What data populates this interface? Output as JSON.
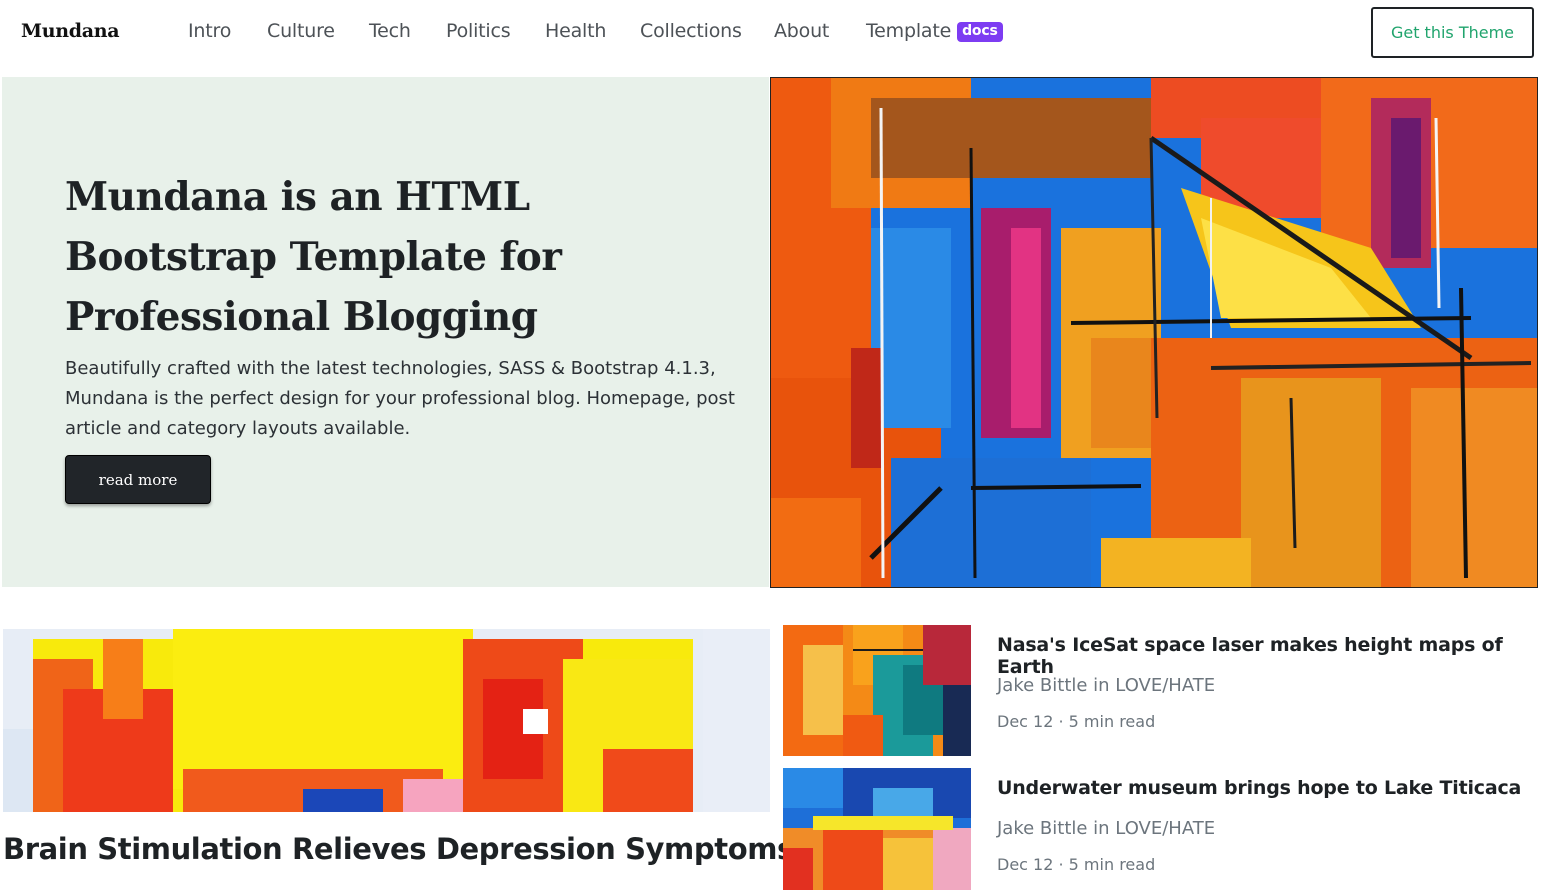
{
  "brand": "Mundana",
  "nav": {
    "items": [
      "Intro",
      "Culture",
      "Tech",
      "Politics",
      "Health",
      "Collections",
      "About"
    ],
    "template_label": "Template",
    "docs_badge": "docs",
    "cta": "Get this Theme"
  },
  "hero": {
    "title_lines": [
      "Mundana is an HTML",
      "Bootstrap Template for",
      "Professional Blogging"
    ],
    "text_lines": [
      "Beautifully crafted with the latest technologies, SASS & Bootstrap 4.1.3,",
      "Mundana is the perfect design for your professional blog. Homepage, post",
      "article and category layouts available."
    ],
    "button": "read more"
  },
  "featured": {
    "title": "Brain Stimulation Relieves Depression Symptoms"
  },
  "articles": [
    {
      "title": "Nasa's IceSat space laser makes height maps of Earth",
      "author": "Jake Bittle in LOVE/HATE",
      "meta": "Dec 12 · 5 min read"
    },
    {
      "title": "Underwater museum brings hope to Lake Titicaca",
      "author": "Jake Bittle in LOVE/HATE",
      "meta": "Dec 12 · 5 min read"
    }
  ],
  "colors": {
    "accent_green": "#20a46d",
    "badge_purple": "#7d3cf2",
    "hero_bg": "#e8f1ea",
    "dark_button": "#212529"
  }
}
